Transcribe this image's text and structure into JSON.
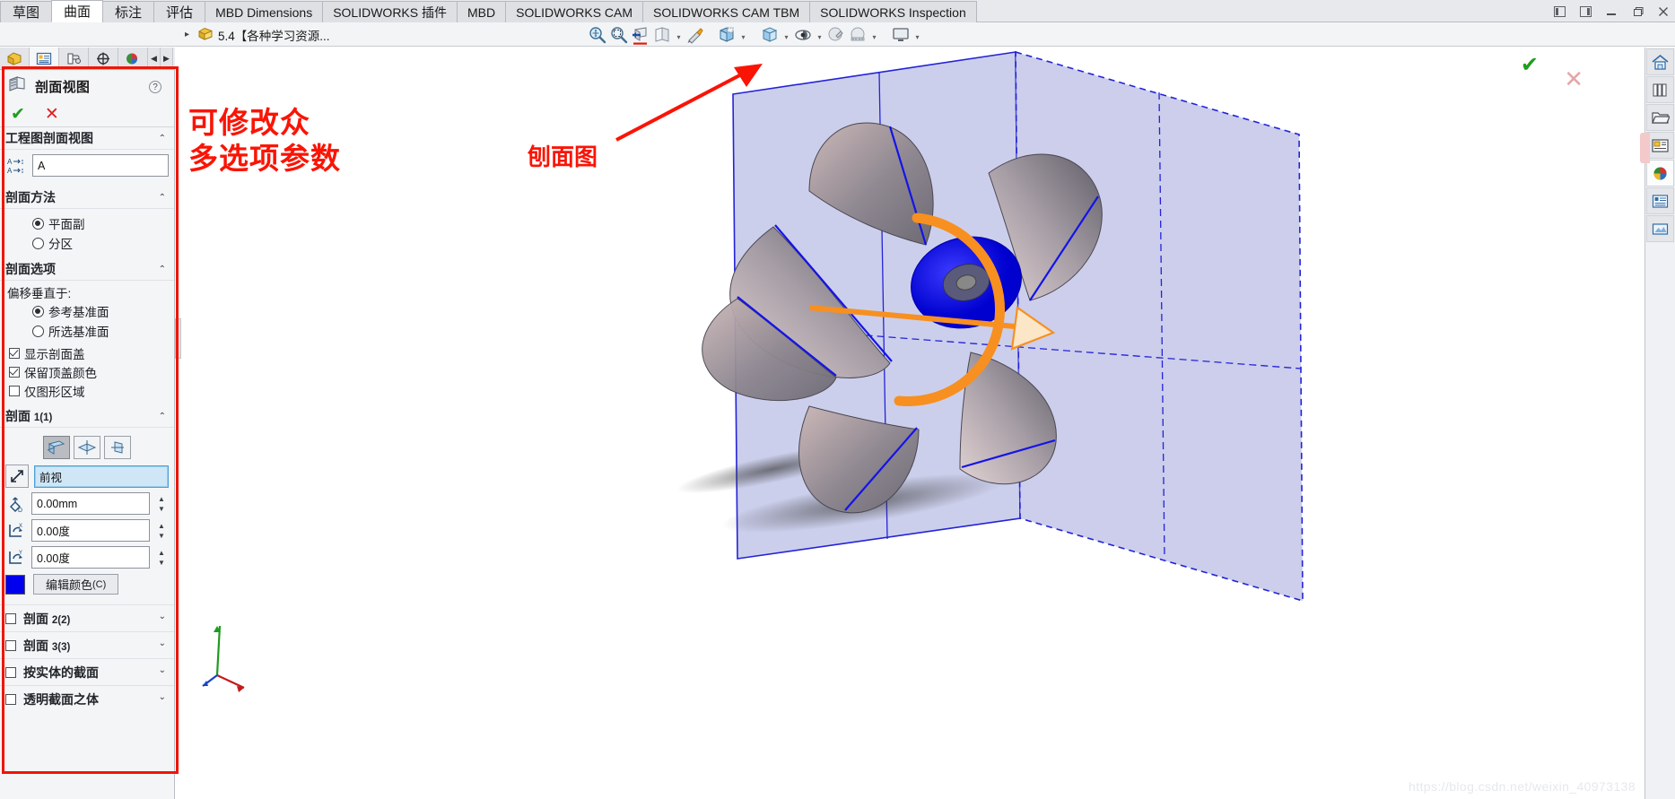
{
  "window": {
    "controls": [
      {
        "name": "restore-left-icon",
        "glyph": "◧"
      },
      {
        "name": "restore-right-icon",
        "glyph": "◨"
      },
      {
        "name": "minimize-icon",
        "glyph": "—"
      },
      {
        "name": "restore-icon",
        "glyph": "❐"
      },
      {
        "name": "close-icon",
        "glyph": "✕"
      }
    ]
  },
  "ribbon_tabs": [
    {
      "label": "草图",
      "active": false,
      "cjk": true
    },
    {
      "label": "曲面",
      "active": true,
      "cjk": true
    },
    {
      "label": "标注",
      "active": false,
      "cjk": true
    },
    {
      "label": "评估",
      "active": false,
      "cjk": true
    },
    {
      "label": "MBD Dimensions",
      "active": false,
      "cjk": false
    },
    {
      "label": "SOLIDWORKS 插件",
      "active": false,
      "cjk": false
    },
    {
      "label": "MBD",
      "active": false,
      "cjk": false
    },
    {
      "label": "SOLIDWORKS CAM",
      "active": false,
      "cjk": false
    },
    {
      "label": "SOLIDWORKS CAM TBM",
      "active": false,
      "cjk": false
    },
    {
      "label": "SOLIDWORKS Inspection",
      "active": false,
      "cjk": false
    }
  ],
  "command_bar": {
    "document_name": "5.4【各种学习资源...",
    "expand_arrow": "▸",
    "view_tools": [
      {
        "name": "zoom-to-fit-icon"
      },
      {
        "name": "zoom-to-area-icon"
      },
      {
        "name": "section-view-icon",
        "active": true
      },
      {
        "name": "view-orientation-icon"
      },
      {
        "name": "display-style-icon"
      },
      {
        "name": "hide-show-items-icon"
      },
      {
        "name": "appearance-icon"
      },
      {
        "name": "scene-icon"
      },
      {
        "name": "view-settings-icon"
      }
    ]
  },
  "panel_tabs": [
    {
      "name": "feature-manager-tab",
      "active": false
    },
    {
      "name": "property-manager-tab",
      "active": true
    },
    {
      "name": "configuration-manager-tab",
      "active": false
    },
    {
      "name": "dimxpert-manager-tab",
      "active": false
    },
    {
      "name": "display-manager-tab",
      "active": false
    }
  ],
  "property_manager": {
    "title": "剖面视图",
    "help_glyph": "?",
    "accept_glyph": "✔",
    "cancel_glyph": "✕",
    "sections": {
      "drawing_section": {
        "title": "工程图剖面视图",
        "chevron": "⌃",
        "name_field_value": "A",
        "name_field_placeholder": ""
      },
      "method_section": {
        "title": "剖面方法",
        "chevron": "⌃",
        "options": [
          {
            "label": "平面副",
            "selected": true
          },
          {
            "label": "分区",
            "selected": false
          }
        ]
      },
      "options_section": {
        "title": "剖面选项",
        "chevron": "⌃",
        "offset_label": "偏移垂直于:",
        "offset_options": [
          {
            "label": "参考基准面",
            "selected": true
          },
          {
            "label": "所选基准面",
            "selected": false
          }
        ],
        "checkboxes": [
          {
            "label": "显示剖面盖",
            "checked": true
          },
          {
            "label": "保留顶盖颜色",
            "checked": true
          },
          {
            "label": "仅图形区域",
            "checked": false
          }
        ]
      },
      "section1": {
        "title": "剖面",
        "title_sub": "1(1)",
        "chevron": "⌃",
        "plane_buttons": [
          {
            "name": "front-plane-button",
            "active": true
          },
          {
            "name": "top-plane-button",
            "active": false
          },
          {
            "name": "right-plane-button",
            "active": false
          }
        ],
        "reference_label": "前视",
        "fields": [
          {
            "name": "offset-distance-field",
            "value": "0.00mm",
            "icon": "distance-icon"
          },
          {
            "name": "rotation-x-field",
            "value": "0.00度",
            "icon": "rotate-x-icon"
          },
          {
            "name": "rotation-y-field",
            "value": "0.00度",
            "icon": "rotate-y-icon"
          }
        ],
        "color_swatch": "#0000ee",
        "edit_color_label": "编辑颜色",
        "edit_color_mnemonic": "(C)"
      }
    },
    "collapsed_rows": [
      {
        "label": "剖面",
        "sub": "2(2)",
        "checked": false,
        "chevron": "⌄"
      },
      {
        "label": "剖面",
        "sub": "3(3)",
        "checked": false,
        "chevron": "⌄"
      },
      {
        "label": "按实体的截面",
        "sub": "",
        "checked": false,
        "chevron": "⌄"
      },
      {
        "label": "透明截面之体",
        "sub": "",
        "checked": false,
        "chevron": "⌄"
      }
    ]
  },
  "viewport": {
    "accept_glyph": "✔",
    "cancel_glyph": "✕",
    "annotations": [
      {
        "name": "annotation-editable-params",
        "line1": "可修改众",
        "line2": "多选项参数"
      },
      {
        "name": "annotation-section-view",
        "text": "刨面图"
      }
    ],
    "watermark": "https://blog.csdn.net/weixin_40973138"
  },
  "right_dock": [
    {
      "name": "home-icon"
    },
    {
      "name": "design-library-icon"
    },
    {
      "name": "file-explorer-icon"
    },
    {
      "name": "view-palette-icon"
    },
    {
      "name": "appearances-scenes-icon",
      "active": true
    },
    {
      "name": "custom-properties-icon"
    },
    {
      "name": "render-tools-icon"
    }
  ],
  "colors": {
    "annotation_red": "#fa1405",
    "highlight_box": "#f01505",
    "accept_green": "#1e9e1e",
    "section_blue": "#0000ee",
    "model_face": "#b9bce4",
    "handle_orange": "#f79020"
  }
}
